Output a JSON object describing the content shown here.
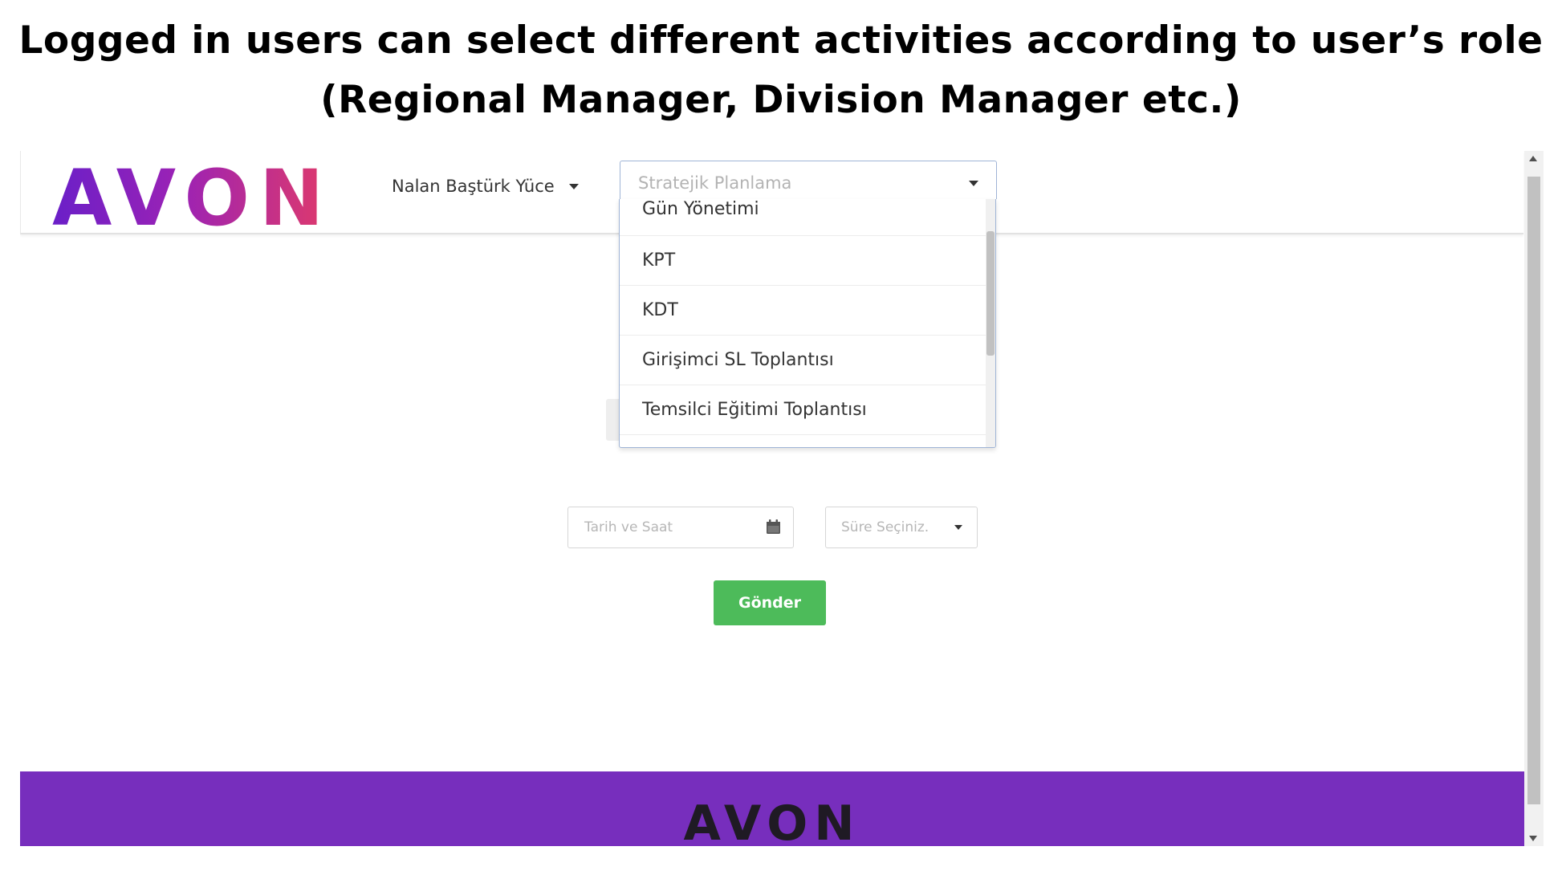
{
  "caption": {
    "line1": "Logged in users can select different activities according to user’s role",
    "line2": "(Regional Manager, Division Manager etc.)"
  },
  "header": {
    "logo_text": "AVON",
    "user_name": "Nalan Baştürk Yüce"
  },
  "activity_select": {
    "selected_value": "Stratejik Planlama",
    "options": [
      "Gün Yönetimi",
      "KPT",
      "KDT",
      "Girişimci SL Toplantısı",
      "Temsilci Eğitimi Toplantısı"
    ]
  },
  "form": {
    "date_placeholder": "Tarih ve Saat",
    "duration_placeholder": "Süre Seçiniz.",
    "submit_label": "Gönder"
  },
  "footer": {
    "logo_text": "AVON"
  },
  "colors": {
    "footer_bg": "#772ebd",
    "button_bg": "#4dbb5a",
    "logo_gradient_start": "#6a1fc8",
    "logo_gradient_end": "#e03a6a"
  },
  "icons": {
    "calendar": "calendar-icon",
    "user_caret": "chevron-down-icon",
    "select_caret": "chevron-down-icon"
  }
}
